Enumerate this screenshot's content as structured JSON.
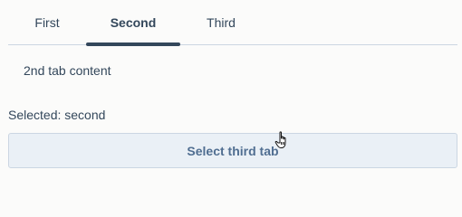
{
  "tabs": {
    "items": [
      {
        "label": "First"
      },
      {
        "label": "Second"
      },
      {
        "label": "Third"
      }
    ],
    "active": "Second"
  },
  "panel": {
    "content": "2nd tab content"
  },
  "status": {
    "text": "Selected: second"
  },
  "actions": {
    "select_third_label": "Select third tab"
  },
  "icons": {
    "cursor": "hand-pointer-icon"
  },
  "colors": {
    "text": "#33475b",
    "active_indicator": "#33475b",
    "button_bg": "#eaf0f6",
    "button_text": "#506e91",
    "divider": "#cbd6e2"
  }
}
